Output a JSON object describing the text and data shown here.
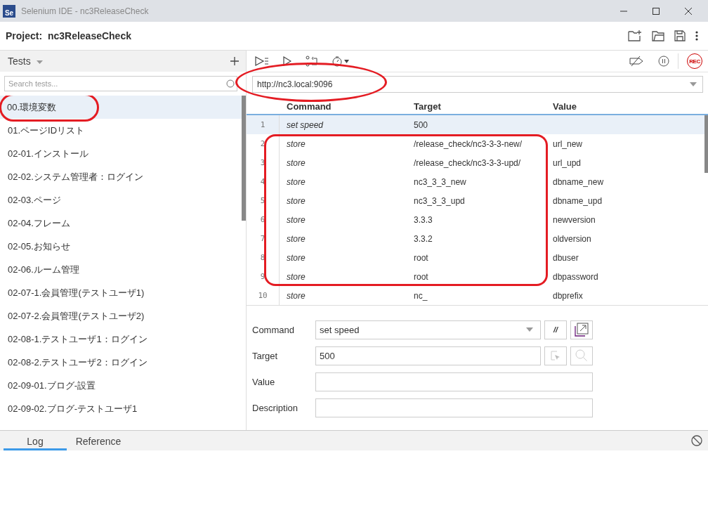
{
  "window": {
    "title": "Selenium IDE - nc3ReleaseCheck",
    "logo": "Se"
  },
  "project": {
    "label": "Project:",
    "name": "nc3ReleaseCheck"
  },
  "tests": {
    "title": "Tests",
    "search": {
      "placeholder": "Search tests..."
    },
    "items": [
      {
        "label": "00.環境変数",
        "selected": true,
        "annotated": true
      },
      {
        "label": "01.ページIDリスト",
        "selected": false,
        "annotated": false
      },
      {
        "label": "02-01.インストール",
        "selected": false,
        "annotated": false
      },
      {
        "label": "02-02.システム管理者：ログイン",
        "selected": false,
        "annotated": false
      },
      {
        "label": "02-03.ページ",
        "selected": false,
        "annotated": false
      },
      {
        "label": "02-04.フレーム",
        "selected": false,
        "annotated": false
      },
      {
        "label": "02-05.お知らせ",
        "selected": false,
        "annotated": false
      },
      {
        "label": "02-06.ルーム管理",
        "selected": false,
        "annotated": false
      },
      {
        "label": "02-07-1.会員管理(テストユーザ1)",
        "selected": false,
        "annotated": false
      },
      {
        "label": "02-07-2.会員管理(テストユーザ2)",
        "selected": false,
        "annotated": false
      },
      {
        "label": "02-08-1.テストユーザ1：ログイン",
        "selected": false,
        "annotated": false
      },
      {
        "label": "02-08-2.テストユーザ2：ログイン",
        "selected": false,
        "annotated": false
      },
      {
        "label": "02-09-01.ブログ-設置",
        "selected": false,
        "annotated": false
      },
      {
        "label": "02-09-02.ブログ-テストユーザ1",
        "selected": false,
        "annotated": false
      }
    ]
  },
  "url": {
    "value": "http://nc3.local:9096",
    "annotated": true
  },
  "table": {
    "columns": [
      "Command",
      "Target",
      "Value"
    ],
    "rows": [
      {
        "n": "1",
        "command": "set speed",
        "target": "500",
        "value": "",
        "selected": true,
        "annotated": false
      },
      {
        "n": "2",
        "command": "store",
        "target": "/release_check/nc3-3-3-new/",
        "value": "url_new",
        "selected": false,
        "annotated": true
      },
      {
        "n": "3",
        "command": "store",
        "target": "/release_check/nc3-3-3-upd/",
        "value": "url_upd",
        "selected": false,
        "annotated": true
      },
      {
        "n": "4",
        "command": "store",
        "target": "nc3_3_3_new",
        "value": "dbname_new",
        "selected": false,
        "annotated": true
      },
      {
        "n": "5",
        "command": "store",
        "target": "nc3_3_3_upd",
        "value": "dbname_upd",
        "selected": false,
        "annotated": true
      },
      {
        "n": "6",
        "command": "store",
        "target": "3.3.3",
        "value": "newversion",
        "selected": false,
        "annotated": true
      },
      {
        "n": "7",
        "command": "store",
        "target": "3.3.2",
        "value": "oldversion",
        "selected": false,
        "annotated": true
      },
      {
        "n": "8",
        "command": "store",
        "target": "root",
        "value": "dbuser",
        "selected": false,
        "annotated": true
      },
      {
        "n": "9",
        "command": "store",
        "target": "root",
        "value": "dbpassword",
        "selected": false,
        "annotated": true
      },
      {
        "n": "10",
        "command": "store",
        "target": "nc_",
        "value": "dbprefix",
        "selected": false,
        "annotated": false
      }
    ]
  },
  "editor": {
    "command": {
      "label": "Command",
      "value": "set speed"
    },
    "target": {
      "label": "Target",
      "value": "500"
    },
    "value": {
      "label": "Value"
    },
    "description": {
      "label": "Description"
    },
    "comment_button": "//"
  },
  "record_button": "REC",
  "bottom_tabs": [
    {
      "label": "Log",
      "selected": true
    },
    {
      "label": "Reference",
      "selected": false
    }
  ]
}
